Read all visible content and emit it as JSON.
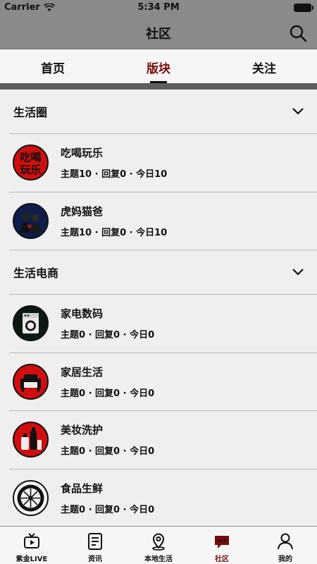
{
  "status_bar": {
    "carrier": "Carrier",
    "time": "5:34 PM"
  },
  "nav": {
    "title": "社区"
  },
  "tabs": [
    {
      "label": "首页",
      "active": false
    },
    {
      "label": "版块",
      "active": true
    },
    {
      "label": "关注",
      "active": false
    }
  ],
  "sections": [
    {
      "title": "生活圈",
      "items": [
        {
          "name": "吃喝玩乐",
          "stats": "主题10 · 回复0 · 今日10",
          "icon": "food-fun-icon"
        },
        {
          "name": "虎妈猫爸",
          "stats": "主题10 · 回复0 · 今日10",
          "icon": "parents-icon"
        }
      ]
    },
    {
      "title": "生活电商",
      "items": [
        {
          "name": "家电数码",
          "stats": "主题0 · 回复0 · 今日0",
          "icon": "washing-machine-icon"
        },
        {
          "name": "家居生活",
          "stats": "主题0 · 回复0 · 今日0",
          "icon": "sofa-icon"
        },
        {
          "name": "美妆洗护",
          "stats": "主题0 · 回复0 · 今日0",
          "icon": "cosmetics-icon"
        },
        {
          "name": "食品生鲜",
          "stats": "主题0 · 回复0 · 今日0",
          "icon": "fresh-food-icon"
        }
      ]
    }
  ],
  "tabbar": [
    {
      "label": "紫金LIVE",
      "icon": "tv-icon",
      "active": false
    },
    {
      "label": "资讯",
      "icon": "news-icon",
      "active": false
    },
    {
      "label": "本地生活",
      "icon": "location-icon",
      "active": false
    },
    {
      "label": "社区",
      "icon": "chat-icon",
      "active": true
    },
    {
      "label": "我的",
      "icon": "profile-icon",
      "active": false
    }
  ],
  "colors": {
    "accent": "#7a0b0b",
    "header_bg": "#8a8a8a",
    "page_bg": "#efefef"
  }
}
